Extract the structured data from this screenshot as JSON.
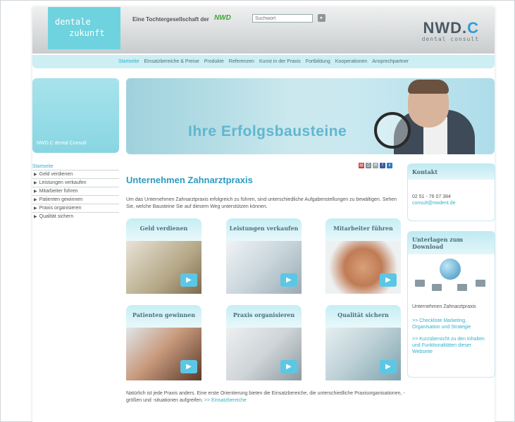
{
  "header": {
    "logo_line1": "dentale",
    "logo_line2": "zukunft",
    "tagline": "Eine Tochtergesellschaft der",
    "tag_logo": "NWD",
    "search_placeholder": "Suchwort",
    "search_button": "▸",
    "brand_main": "NWD.",
    "brand_c": "C",
    "brand_sub": "dental consult"
  },
  "nav": {
    "items": [
      "Startseite",
      "Einsatzbereiche & Preise",
      "Produkte",
      "Referenzen",
      "Kunst in der Praxis",
      "Fortbildung",
      "Kooperationen",
      "Ansprechpartner"
    ],
    "active_index": 0
  },
  "left": {
    "box_text": "NWD.C dental Consult",
    "sidenav_title": "Startseite",
    "sidenav_items": [
      "Geld verdienen",
      "Leistungen verkaufen",
      "Mitarbeiter führen",
      "Patienten gewinnen",
      "Praxis organisieren",
      "Qualität sichern"
    ]
  },
  "banner": {
    "headline": "Ihre Erfolgsbausteine"
  },
  "main": {
    "title": "Unternehmen Zahnarztpraxis",
    "intro": "Um das Unternehmen Zahnarztpraxis erfolgreich zu führen, sind unterschiedliche Aufgabenstellungen zu bewältigen. Sehen Sie, welche Bausteine Sie auf diesem Weg unterstützen können.",
    "cards": [
      "Geld verdienen",
      "Leistungen verkaufen",
      "Mitarbeiter führen",
      "Patienten gewinnen",
      "Praxis organisieren",
      "Qualität sichern"
    ],
    "footer_text": "Natürlich ist jede Praxis anders. Eine erste Orientierung bieten die Einsatzbereiche, die unterschiedliche Praxisorganisationen, -größen und -situationen aufgreifen.",
    "footer_link": ">> Einsatzbereiche"
  },
  "sidebar_right": {
    "contact_title": "Kontakt",
    "phone": "02 51 - 76 07 384",
    "email": "consult@nwdent.de",
    "downloads_title": "Unterlagen zum Download",
    "downloads_subtitle": "Unternehmen Zahnarztpraxis",
    "link1": ">> Checkliste Marketing, Organisation und Strategie",
    "link2": ">> Kurzübersicht zu den Inhalten und Funktionalitäten dieser Webseite"
  },
  "colors": {
    "accent": "#34b0c8",
    "nav_bg": "#cdeef3",
    "logo_bg": "#6ed3df"
  }
}
